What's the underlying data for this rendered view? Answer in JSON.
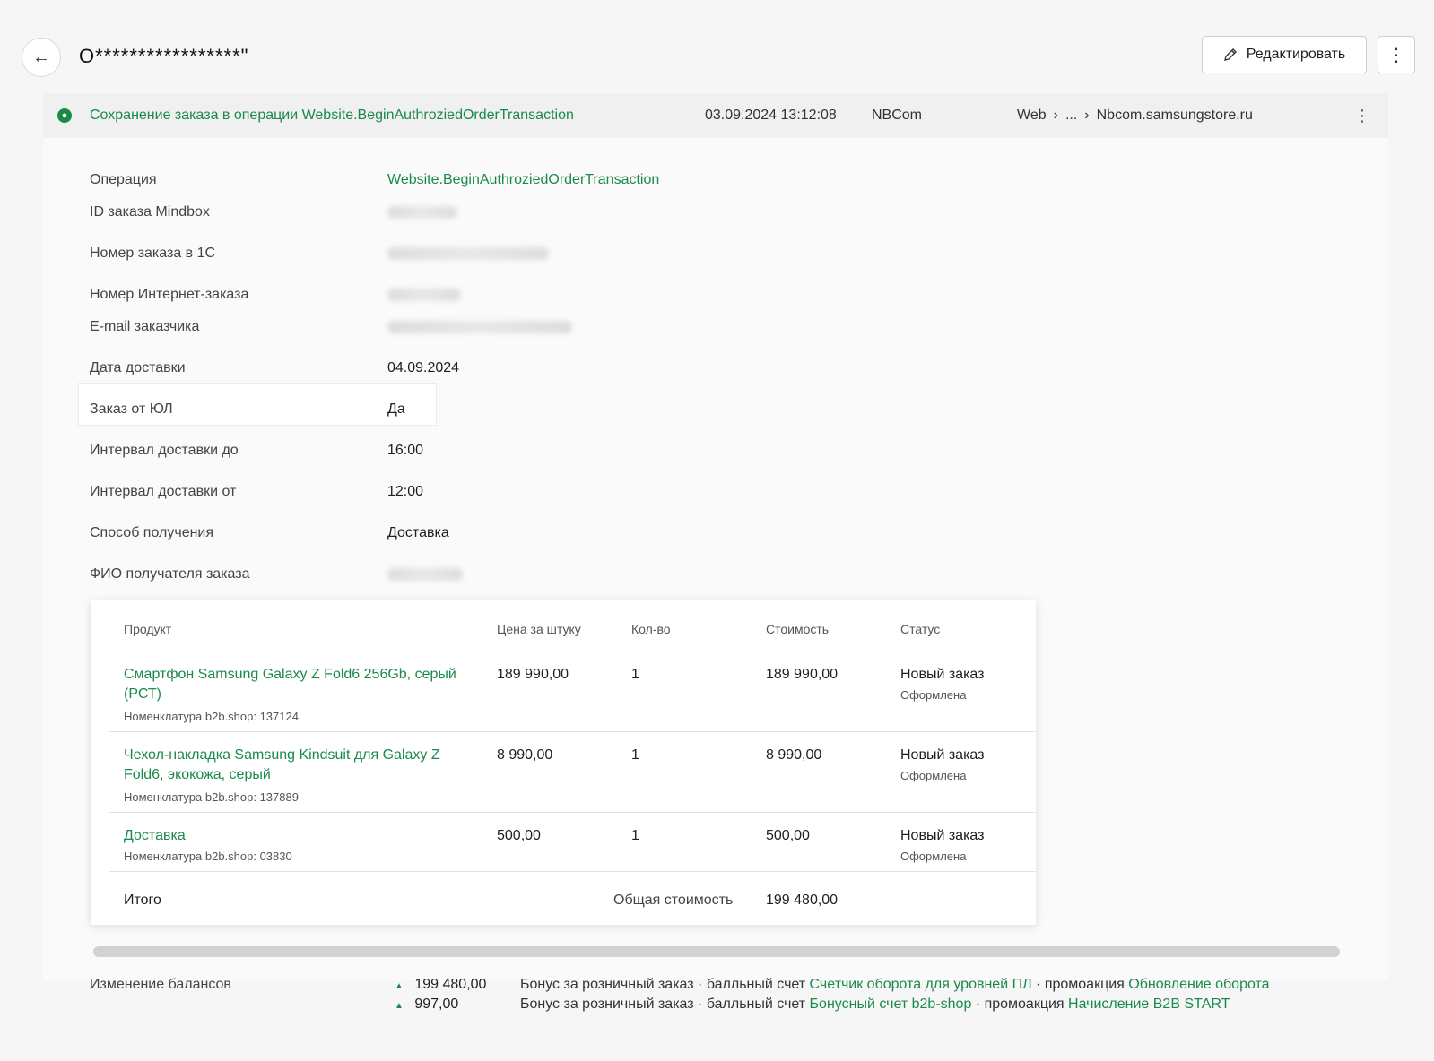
{
  "header": {
    "title": "O*****************\"",
    "edit_label": "Редактировать",
    "back_icon": "arrow-left-icon",
    "more_icon": "vertical-dots-icon"
  },
  "event": {
    "title": "Сохранение заказа в операции Website.BeginAuthroziedOrderTransaction",
    "datetime": "03.09.2024 13:12:08",
    "brand": "NBCom",
    "crumb_1": "Web",
    "crumb_2": "...",
    "crumb_3": "Nbcom.samsungstore.ru",
    "crumb_sep": "›",
    "status_color": "#1a8a4a"
  },
  "fields": [
    {
      "label": "Операция",
      "value": "Website.BeginAuthroziedOrderTransaction"
    },
    {
      "label": "ID заказа Mindbox",
      "value": ""
    },
    {
      "label": "Номер заказа в 1С",
      "value": ""
    },
    {
      "label": "Номер Интернет-заказа",
      "value": ""
    },
    {
      "label": "E-mail заказчика",
      "value": ""
    },
    {
      "label": "Дата доставки",
      "value": "04.09.2024"
    },
    {
      "label": "Заказ от ЮЛ",
      "value": "Да"
    },
    {
      "label": "Интервал доставки до",
      "value": "16:00"
    },
    {
      "label": "Интервал доставки от",
      "value": "12:00"
    },
    {
      "label": "Способ получения",
      "value": "Доставка"
    },
    {
      "label": "ФИО получателя заказа",
      "value": ""
    }
  ],
  "table": {
    "headers": {
      "product": "Продукт",
      "price": "Цена за штуку",
      "qty": "Кол-во",
      "cost": "Стоимость",
      "status": "Статус"
    },
    "rows": [
      {
        "name_line1": "Смартфон Samsung Galaxy Z Fold6 256Gb, серый",
        "name_line2": "(РСТ)",
        "sku": "Номенклатура b2b.shop: 137124",
        "price": "189 990,00",
        "qty": "1",
        "cost": "189 990,00",
        "status": "Новый заказ",
        "substatus": "Оформлена"
      },
      {
        "name_line1": "Чехол-накладка Samsung Kindsuit для Galaxy Z",
        "name_line2": "Fold6, экокожа, серый",
        "sku": "Номенклатура b2b.shop: 137889",
        "price": "8 990,00",
        "qty": "1",
        "cost": "8 990,00",
        "status": "Новый заказ",
        "substatus": "Оформлена"
      },
      {
        "name_line1": "Доставка",
        "name_line2": "",
        "sku": "Номенклатура b2b.shop: 03830",
        "price": "500,00",
        "qty": "1",
        "cost": "500,00",
        "status": "Новый заказ",
        "substatus": "Оформлена"
      }
    ],
    "total_label": "Итого",
    "total_cost_label": "Общая стоимость",
    "total_cost": "199 480,00"
  },
  "balances": {
    "label": "Изменение балансов",
    "rows": [
      {
        "amount": "199 480,00",
        "text_1": "Бонус за розничный заказ · балльный счет ",
        "link_1": "Счетчик оборота для уровней ПЛ",
        "text_2": " · промоакция ",
        "link_2": "Обновление оборота"
      },
      {
        "amount": "997,00",
        "text_1": "Бонус за розничный заказ · балльный счет ",
        "link_1": "Бонусный счет b2b-shop",
        "text_2": " · промоакция ",
        "link_2": "Начисление B2B START"
      }
    ]
  }
}
